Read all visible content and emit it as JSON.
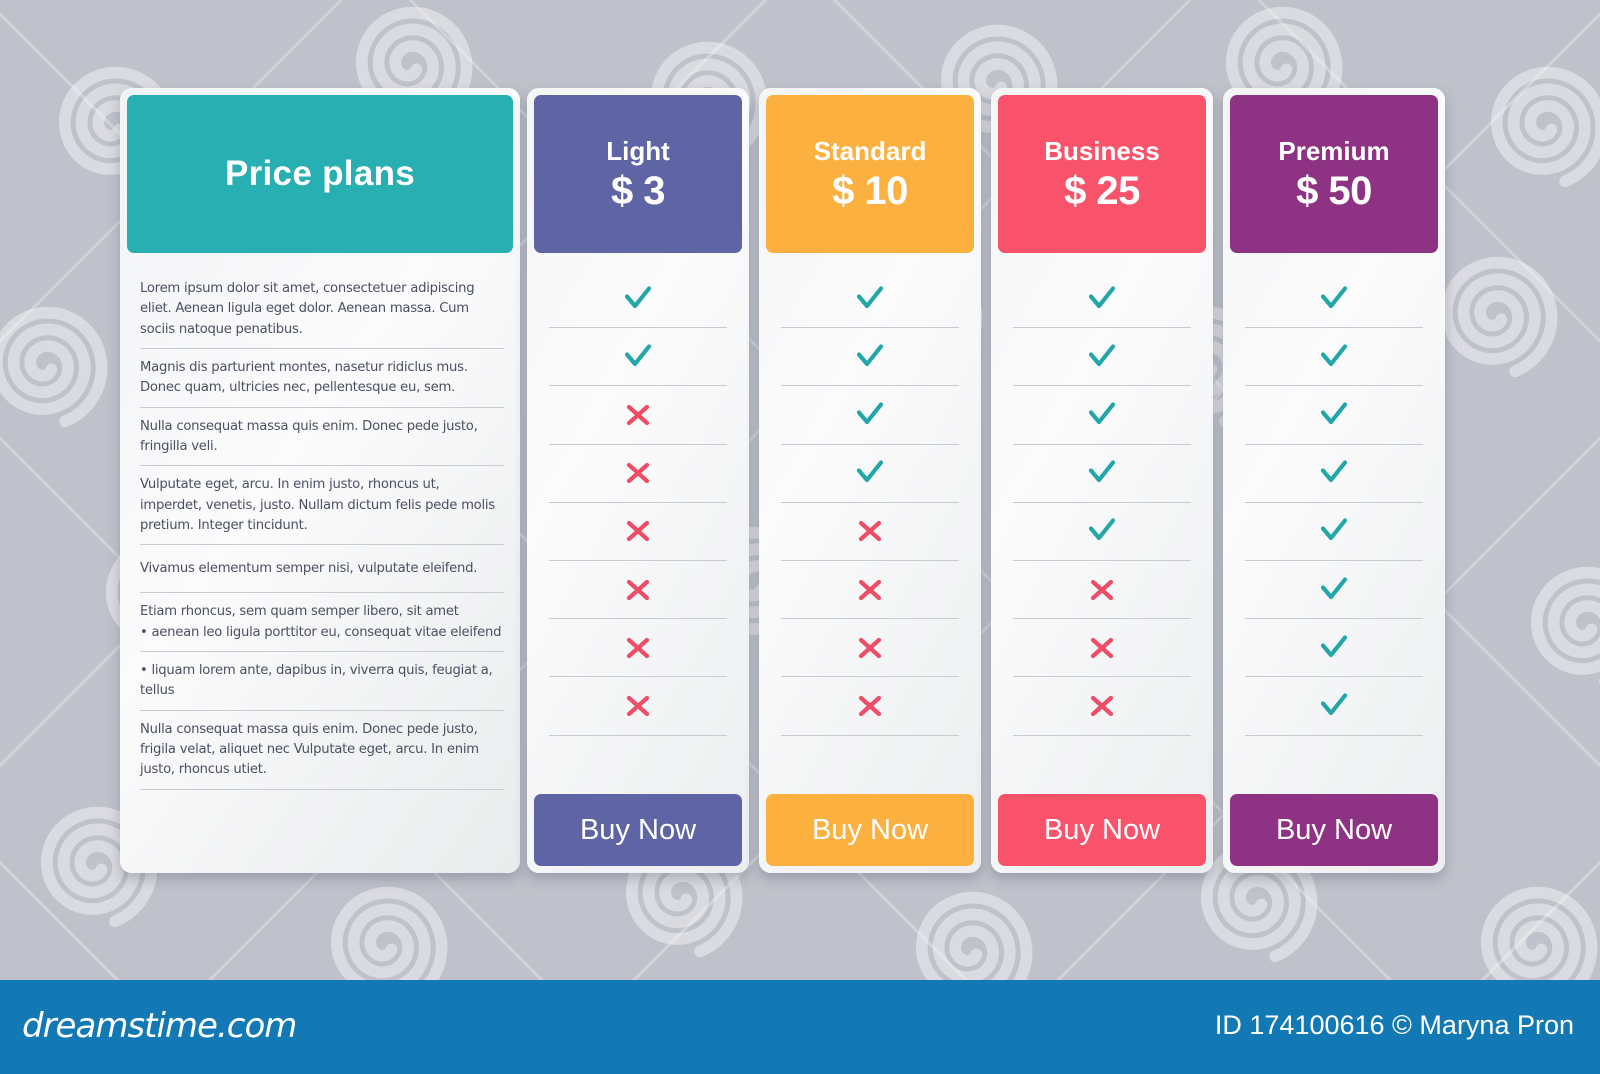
{
  "background": {
    "color": "#bfc2ca",
    "watermark_text": "dreamstime"
  },
  "features_panel": {
    "title": "Price plans",
    "header_color": "#28afb2",
    "rows": [
      "Lorem ipsum dolor sit amet, consectetuer adipiscing eliet. Aenean ligula eget dolor. Aenean massa. Cum sociis natoque penatibus.",
      "Magnis dis parturient montes, nasetur ridiclus mus. Donec quam, ultricies nec, pellentesque eu, sem.",
      "Nulla consequat massa quis enim. Donec pede justo, fringilla veli.",
      "Vulputate eget, arcu. In enim justo, rhoncus ut, imperdet, venetis, justo. Nullam dictum felis pede molis pretium. Integer tincidunt.",
      "Vivamus elementum semper nisi, vulputate eleifend.",
      "Etiam rhoncus, sem quam semper libero, sit amet\n• aenean leo ligula porttitor eu, consequat vitae eleifend",
      "• liquam lorem ante, dapibus in, viverra quis, feugiat a, tellus",
      "Nulla consequat massa quis enim. Donec pede justo, frigila velat, aliquet nec Vulputate eget, arcu. In enim justo, rhoncus utiet."
    ]
  },
  "mark_colors": {
    "check": "#22a6a9",
    "cross": "#ef4c66"
  },
  "plans": [
    {
      "name": "Light",
      "price": "$ 3",
      "color": "#5f64a4",
      "buy_label": "Buy Now",
      "marks": [
        "check",
        "check",
        "cross",
        "cross",
        "cross",
        "cross",
        "cross",
        "cross"
      ]
    },
    {
      "name": "Standard",
      "price": "$ 10",
      "color": "#fbb03f",
      "buy_label": "Buy Now",
      "marks": [
        "check",
        "check",
        "check",
        "check",
        "cross",
        "cross",
        "cross",
        "cross"
      ]
    },
    {
      "name": "Business",
      "price": "$ 25",
      "color": "#f9526b",
      "buy_label": "Buy Now",
      "marks": [
        "check",
        "check",
        "check",
        "check",
        "check",
        "cross",
        "cross",
        "cross"
      ]
    },
    {
      "name": "Premium",
      "price": "$ 50",
      "color": "#8e3384",
      "buy_label": "Buy Now",
      "marks": [
        "check",
        "check",
        "check",
        "check",
        "check",
        "check",
        "check",
        "check"
      ]
    }
  ],
  "footer": {
    "logo_text": "dreamstime.com",
    "credit": "ID 174100616 © Maryna Pron",
    "bar_color": "#1279b5"
  }
}
